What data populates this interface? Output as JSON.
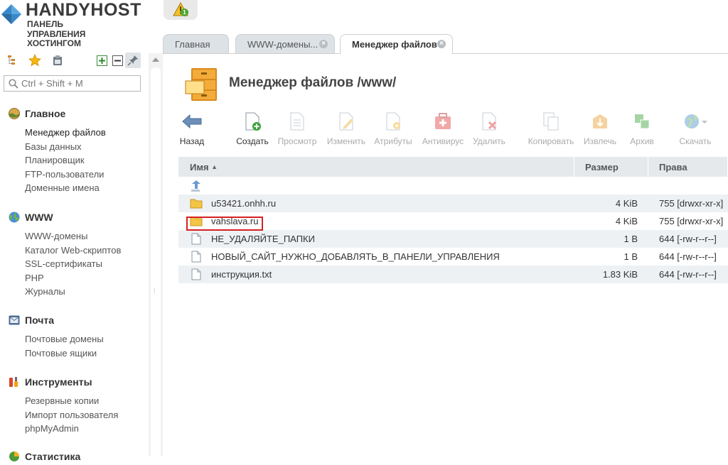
{
  "brand": {
    "name": "HANDYHOST",
    "subtitle_lines": [
      "ПАНЕЛЬ",
      "УПРАВЛЕНИЯ",
      "ХОСТИНГОМ"
    ]
  },
  "alert": {
    "count": "1",
    "icon": "warning-icon"
  },
  "search": {
    "placeholder": "Ctrl + Shift + M"
  },
  "sidebar": {
    "tools": [
      "tree-icon",
      "star-icon",
      "clipboard-icon",
      "expand-icon",
      "collapse-icon",
      "pin-icon"
    ],
    "sections": [
      {
        "title": "Главное",
        "icon": "globe-icon",
        "items": [
          "Менеджер файлов",
          "Базы данных",
          "Планировщик",
          "FTP-пользователи",
          "Доменные имена"
        ]
      },
      {
        "title": "WWW",
        "icon": "world-icon",
        "items": [
          "WWW-домены",
          "Каталог Web-скриптов",
          "SSL-сертификаты",
          "PHP",
          "Журналы"
        ]
      },
      {
        "title": "Почта",
        "icon": "mail-icon",
        "items": [
          "Почтовые домены",
          "Почтовые ящики"
        ]
      },
      {
        "title": "Инструменты",
        "icon": "tools-icon",
        "items": [
          "Резервные копии",
          "Импорт пользователя",
          "phpMyAdmin"
        ]
      },
      {
        "title": "Статистика",
        "icon": "chart-icon",
        "items": []
      }
    ]
  },
  "tabs": [
    {
      "label": "Главная",
      "closable": false
    },
    {
      "label": "WWW-домены...",
      "closable": true
    },
    {
      "label": "Менеджер файлов",
      "closable": true,
      "active": true
    }
  ],
  "page": {
    "title": "Менеджер файлов /www/"
  },
  "toolbar": [
    {
      "label": "Назад",
      "icon": "back-arrow-icon",
      "enabled": true
    },
    {
      "label": "Создать",
      "icon": "new-file-icon",
      "enabled": true
    },
    {
      "label": "Просмотр",
      "icon": "view-icon",
      "enabled": false
    },
    {
      "label": "Изменить",
      "icon": "edit-icon",
      "enabled": false
    },
    {
      "label": "Атрибуты",
      "icon": "attributes-icon",
      "enabled": false
    },
    {
      "label": "Антивирус",
      "icon": "antivirus-icon",
      "enabled": false
    },
    {
      "label": "Удалить",
      "icon": "delete-icon",
      "enabled": false
    },
    {
      "label": "Копировать",
      "icon": "copy-icon",
      "enabled": false
    },
    {
      "label": "Извлечь",
      "icon": "extract-icon",
      "enabled": false
    },
    {
      "label": "Архив",
      "icon": "archive-icon",
      "enabled": false
    },
    {
      "label": "Скачать",
      "icon": "download-icon",
      "enabled": false
    }
  ],
  "table": {
    "columns": [
      "Имя",
      "Размер",
      "Права"
    ],
    "rows": [
      {
        "type": "up",
        "name": "",
        "size": "",
        "perms": ""
      },
      {
        "type": "folder",
        "name": "u53421.onhh.ru",
        "size": "4 KiB",
        "perms": "755 [drwxr-xr-x]"
      },
      {
        "type": "folder",
        "name": "vahslava.ru",
        "size": "4 KiB",
        "perms": "755 [drwxr-xr-x]",
        "highlighted": true
      },
      {
        "type": "file",
        "name": "НЕ_УДАЛЯЙТЕ_ПАПКИ",
        "size": "1 B",
        "perms": "644 [-rw-r--r--]"
      },
      {
        "type": "file",
        "name": "НОВЫЙ_САЙТ_НУЖНО_ДОБАВЛЯТЬ_В_ПАНЕЛИ_УПРАВЛЕНИЯ",
        "size": "1 B",
        "perms": "644 [-rw-r--r--]"
      },
      {
        "type": "file",
        "name": "инструкция.txt",
        "size": "1.83 KiB",
        "perms": "644 [-rw-r--r--]"
      }
    ]
  },
  "colors": {
    "highlight_border": "#d62020",
    "header_bg": "#e6e9ec",
    "row_alt": "#eef1f4",
    "folder": "#f3c545"
  }
}
